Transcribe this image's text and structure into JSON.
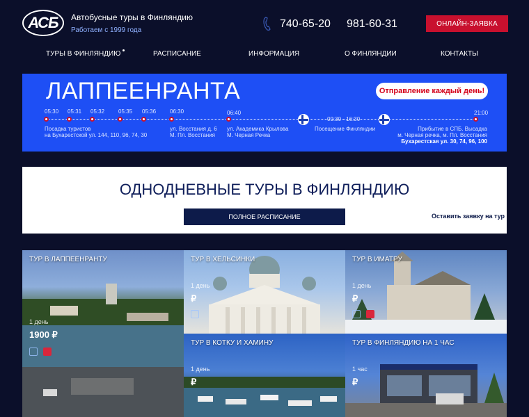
{
  "header": {
    "logo_text": "АСБ",
    "tagline": "Автобусные туры в Финляндию",
    "since": "Работаем с 1999 года",
    "phone1": "740-65-20",
    "phone2": "981-60-31",
    "online_button": "ОНЛАЙН-ЗАЯВКА"
  },
  "nav": {
    "items": [
      "ТУРЫ В ФИНЛЯНДИЮ",
      "РАСПИСАНИЕ",
      "ИНФОРМАЦИЯ",
      "О ФИНЛЯНДИИ",
      "КОНТАКТЫ"
    ]
  },
  "banner": {
    "title": "ЛАППЕЕНРАНТА",
    "departure_button": "Отправление каждый день!",
    "times": [
      "05:30",
      "05:31",
      "05:32",
      "05:35",
      "05:36",
      "06:30",
      "06:40",
      "09:30 - 16:30",
      "21:00"
    ],
    "stop1": [
      "Посадка туристов",
      "на Бухарестской ул. 144, 110, 96, 74, 30"
    ],
    "stop2": [
      "ул. Восстания д. 6",
      "М. Пл. Восстания"
    ],
    "stop3": [
      "ул. Академика Крылова",
      "М. Черная Речка"
    ],
    "stop4": [
      "Посещение Финляндии"
    ],
    "stop5": [
      "Прибытие в СПБ. Высадка",
      "м. Черная речка, м. Пл. Восстания",
      "Бухарестская ул. 30, 74, 96, 100"
    ]
  },
  "section": {
    "title": "ОДНОДНЕВНЫЕ ТУРЫ В ФИНЛЯНДИЮ",
    "schedule_button": "ПОЛНОЕ РАСПИСАНИЕ",
    "request_link": "Оставить заявку на тур"
  },
  "tiles": [
    {
      "title": "ТУР В ЛАППЕЕНРАНТУ",
      "days": "1 день",
      "price": "1900 ₽"
    },
    {
      "title": "ТУР В ХЕЛЬСИНКИ",
      "days": "1 день",
      "price": "₽"
    },
    {
      "title": "ТУР В ИМАТРУ",
      "days": "1 день",
      "price": "₽"
    },
    {
      "title": "ТУР В КОТКУ И ХАМИНУ",
      "days": "1 день",
      "price": "₽"
    },
    {
      "title": "ТУР В ФИНЛЯНДИЮ НА 1 ЧАС",
      "days": "1 час",
      "price": "₽"
    }
  ],
  "colors": {
    "background": "#0b0f2a",
    "banner": "#1e4ff5",
    "accent_red": "#c8102e",
    "navy": "#0d1b4a"
  },
  "icons": [
    "phone-icon",
    "finland-flag-icon",
    "bus-icon",
    "bag-icon"
  ]
}
